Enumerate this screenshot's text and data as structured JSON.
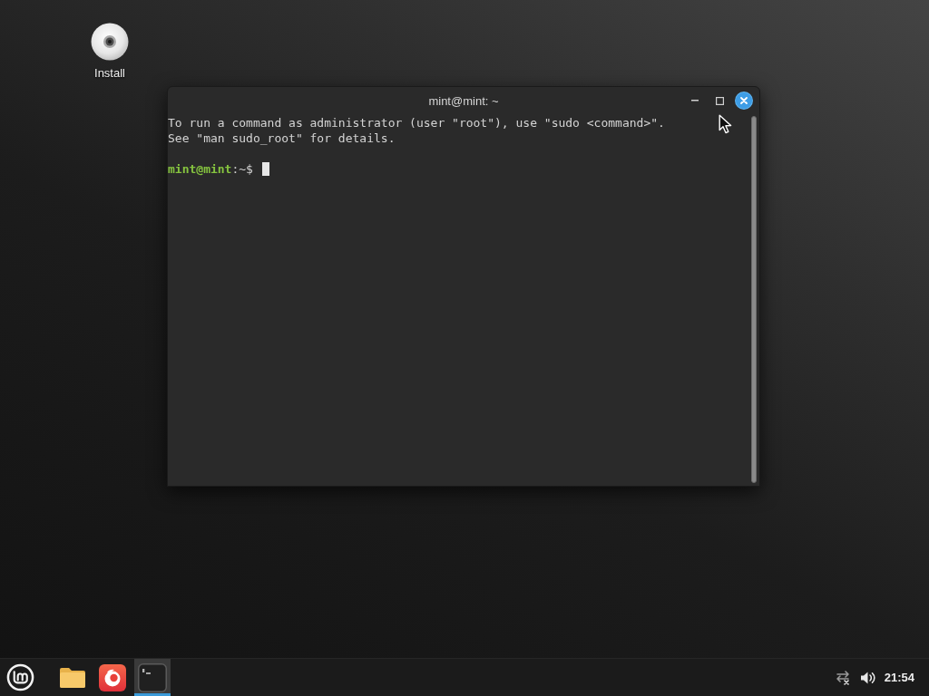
{
  "desktop": {
    "icons": [
      {
        "kind": "disc",
        "label": "Install"
      }
    ]
  },
  "window": {
    "title": "mint@mint: ~",
    "output": [
      "To run a command as administrator (user \"root\"), use \"sudo <command>\".",
      "See \"man sudo_root\" for details."
    ],
    "prompt": {
      "user_host": "mint@mint",
      "path": ":~$"
    }
  },
  "taskbar": {
    "launchers": [
      {
        "kind": "folder",
        "active": false
      },
      {
        "kind": "swirl",
        "active": false
      },
      {
        "kind": "terminal",
        "active": true
      }
    ],
    "clock": "21:54"
  }
}
